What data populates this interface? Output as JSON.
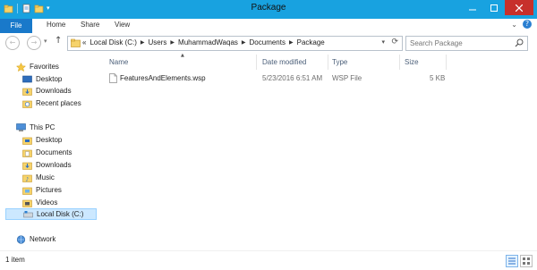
{
  "window": {
    "title": "Package",
    "accent": "#18a2e0"
  },
  "ribbon": {
    "tabs": [
      "File",
      "Home",
      "Share",
      "View"
    ]
  },
  "address": {
    "crumbs": [
      "Local Disk (C:)",
      "Users",
      "MuhammadWaqas",
      "Documents",
      "Package"
    ],
    "overflow": "«"
  },
  "search": {
    "placeholder": "Search Package"
  },
  "nav": {
    "favorites": {
      "label": "Favorites",
      "items": [
        "Desktop",
        "Downloads",
        "Recent places"
      ]
    },
    "thispc": {
      "label": "This PC",
      "items": [
        "Desktop",
        "Documents",
        "Downloads",
        "Music",
        "Pictures",
        "Videos",
        "Local Disk (C:)"
      ]
    },
    "network": {
      "label": "Network"
    }
  },
  "columns": [
    "Name",
    "Date modified",
    "Type",
    "Size"
  ],
  "files": [
    {
      "name": "FeaturesAndElements.wsp",
      "date_modified": "5/23/2016 6:51 AM",
      "type": "WSP File",
      "size": "5 KB",
      "icon": "file-icon"
    }
  ],
  "status": {
    "count": "1 item"
  }
}
